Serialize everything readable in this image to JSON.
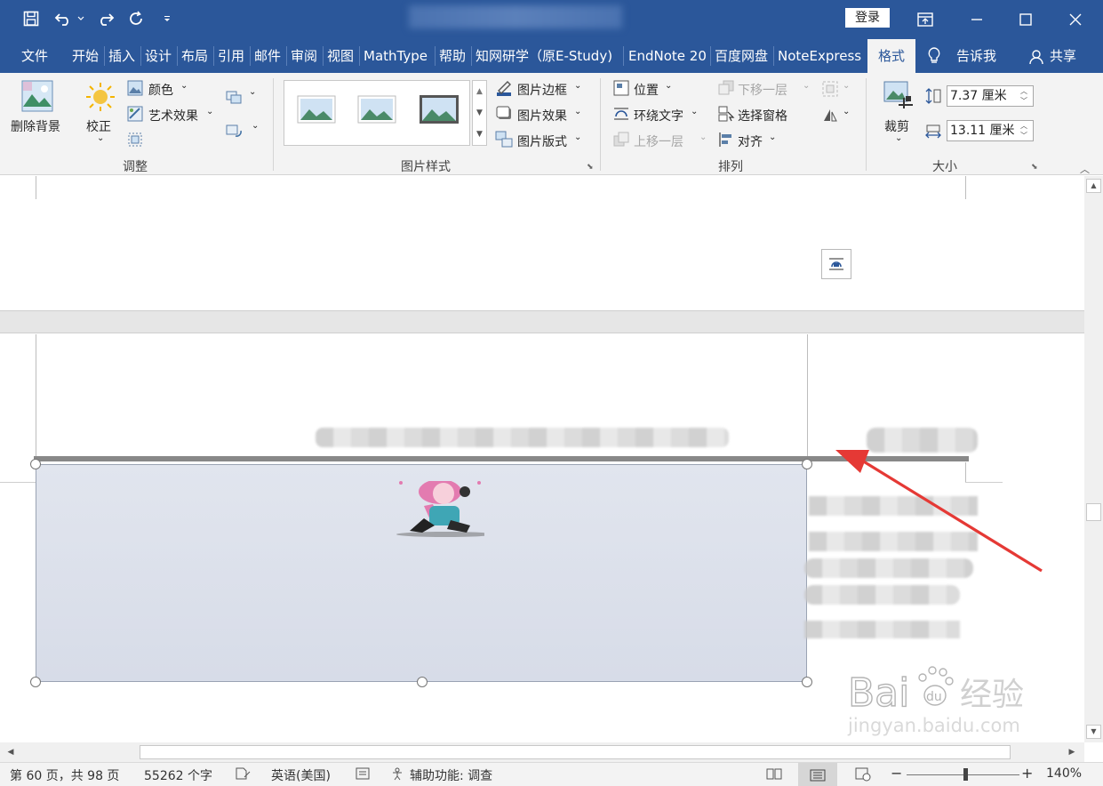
{
  "login": "登录",
  "tabs": [
    {
      "label": "文件"
    },
    {
      "label": "开始"
    },
    {
      "label": "插入"
    },
    {
      "label": "设计"
    },
    {
      "label": "布局"
    },
    {
      "label": "引用"
    },
    {
      "label": "邮件"
    },
    {
      "label": "审阅"
    },
    {
      "label": "视图"
    },
    {
      "label": "MathType"
    },
    {
      "label": "帮助"
    },
    {
      "label": "知网研学（原E-Study)"
    },
    {
      "label": "EndNote 20"
    },
    {
      "label": "百度网盘"
    },
    {
      "label": "NoteExpress"
    },
    {
      "label": "格式"
    },
    {
      "label": "告诉我"
    },
    {
      "label": "共享"
    }
  ],
  "ribbon": {
    "remove_bg": "删除背景",
    "corrections": "校正",
    "color": "颜色",
    "artistic": "艺术效果",
    "group_adjust": "调整",
    "border": "图片边框",
    "effects": "图片效果",
    "layout": "图片版式",
    "group_styles": "图片样式",
    "position": "位置",
    "wrap_text": "环绕文字",
    "bring_forward": "上移一层",
    "send_backward": "下移一层",
    "selection_pane": "选择窗格",
    "align": "对齐",
    "group_arrange": "排列",
    "crop": "裁剪",
    "height": "7.37 厘米",
    "width": "13.11 厘米",
    "group_size": "大小"
  },
  "status": {
    "page": "第 60 页，共 98 页",
    "words": "55262 个字",
    "language": "英语(美国)",
    "accessibility": "辅助功能: 调查",
    "zoom": "140%"
  },
  "watermark": {
    "site": "jingyan.baidu.com",
    "brand": "经验"
  },
  "colors": {
    "accent": "#2b579a",
    "arrow": "#e53935",
    "picture_fill": "#dde2ec"
  }
}
